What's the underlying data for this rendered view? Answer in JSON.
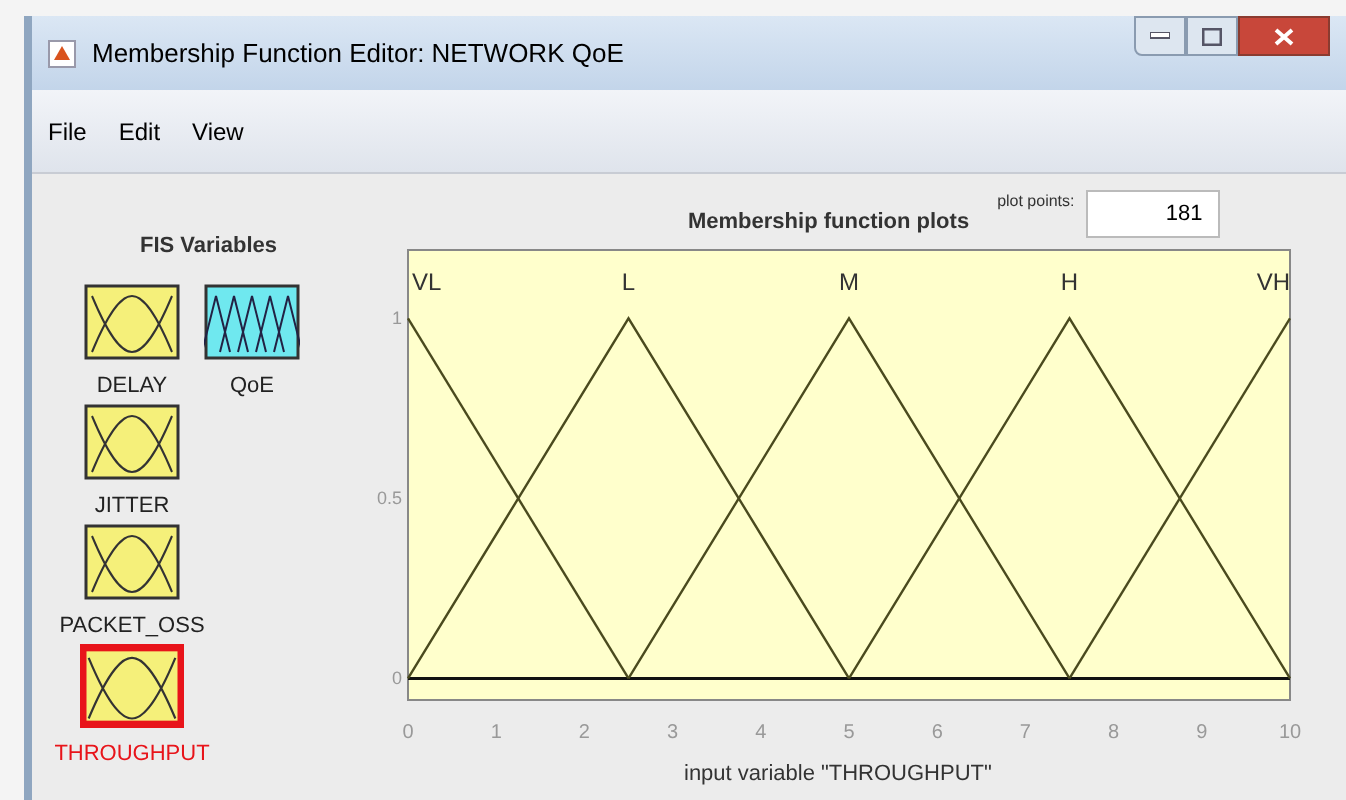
{
  "window": {
    "title": "Membership Function Editor: NETWORK QoE"
  },
  "menu": [
    "File",
    "Edit",
    "View"
  ],
  "fis_variables": {
    "title": "FIS Variables",
    "items": [
      {
        "label": "DELAY",
        "kind": "input",
        "selected": false
      },
      {
        "label": "QoE",
        "kind": "output",
        "selected": false
      },
      {
        "label": "JITTER",
        "kind": "input",
        "selected": false
      },
      {
        "label": "PACKET_OSS",
        "kind": "input",
        "selected": false
      },
      {
        "label": "THROUGHPUT",
        "kind": "input",
        "selected": true
      }
    ]
  },
  "plot": {
    "plot_points_label": "plot points:",
    "plot_points": "181",
    "chart_data": {
      "type": "line",
      "title": "Membership function plots",
      "xlabel": "input variable \"THROUGHPUT\"",
      "x": [
        0,
        2.5,
        5,
        7.5,
        10
      ],
      "series": [
        {
          "name": "VL",
          "color": "#4a4a1e",
          "values": [
            1,
            0,
            null,
            null,
            null
          ]
        },
        {
          "name": "L",
          "color": "#4a4a1e",
          "values": [
            0,
            1,
            0,
            null,
            null
          ]
        },
        {
          "name": "M",
          "color": "#4a4a1e",
          "values": [
            null,
            0,
            1,
            0,
            null
          ]
        },
        {
          "name": "H",
          "color": "#4a4a1e",
          "values": [
            null,
            null,
            0,
            1,
            0
          ]
        },
        {
          "name": "VH",
          "color": "#4a4a1e",
          "values": [
            null,
            null,
            null,
            0,
            1
          ]
        }
      ],
      "xlim": [
        0,
        10
      ],
      "ylim": [
        -0.06,
        1.19
      ],
      "xticks": [
        0,
        1,
        2,
        3,
        4,
        5,
        6,
        7,
        8,
        9,
        10
      ],
      "yticks": [
        0,
        {
          "value": 0.5,
          "label": "0.5"
        },
        1
      ]
    }
  }
}
